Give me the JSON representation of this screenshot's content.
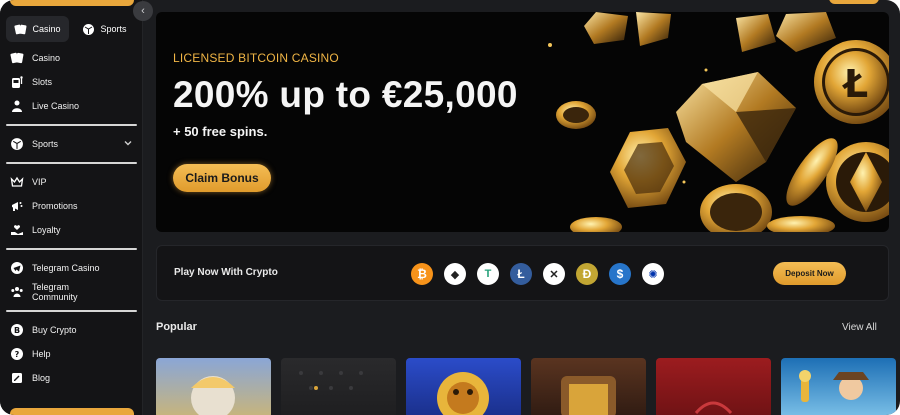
{
  "sidebar": {
    "tabs": [
      {
        "label": "Casino",
        "icon": "cards-icon"
      },
      {
        "label": "Sports",
        "icon": "ball-icon"
      }
    ],
    "group1": [
      {
        "label": "Casino",
        "icon": "cards-icon"
      },
      {
        "label": "Slots",
        "icon": "slot-machine-icon"
      },
      {
        "label": "Live Casino",
        "icon": "dealer-icon"
      }
    ],
    "group2": [
      {
        "label": "Sports",
        "icon": "ball-icon"
      }
    ],
    "group3": [
      {
        "label": "VIP",
        "icon": "crown-icon"
      },
      {
        "label": "Promotions",
        "icon": "megaphone-icon"
      },
      {
        "label": "Loyalty",
        "icon": "hand-heart-icon"
      }
    ],
    "group4": [
      {
        "label": "Telegram Casino",
        "icon": "telegram-icon"
      },
      {
        "label": "Telegram Community",
        "icon": "community-icon"
      }
    ],
    "group5": [
      {
        "label": "Buy Crypto",
        "icon": "bitcoin-icon"
      },
      {
        "label": "Help",
        "icon": "help-icon"
      },
      {
        "label": "Blog",
        "icon": "blog-icon"
      }
    ]
  },
  "hero": {
    "kicker": "LICENSED BITCOIN CASINO",
    "title": "200% up to €25,000",
    "subtitle": "+ 50 free spins.",
    "cta": "Claim Bonus"
  },
  "crypto": {
    "label": "Play Now With Crypto",
    "coins": [
      {
        "name": "bitcoin",
        "color": "#f7931a",
        "glyph": "₿"
      },
      {
        "name": "ethereum",
        "color": "#ffffff",
        "glyph": "◆"
      },
      {
        "name": "tether",
        "color": "#ffffff",
        "glyph": "T"
      },
      {
        "name": "litecoin",
        "color": "#345d9d",
        "glyph": "Ł"
      },
      {
        "name": "ripple",
        "color": "#ffffff",
        "glyph": "✕"
      },
      {
        "name": "dogecoin",
        "color": "#c2a633",
        "glyph": "Ð"
      },
      {
        "name": "usd-coin",
        "color": "#2775ca",
        "glyph": "$"
      },
      {
        "name": "cardano",
        "color": "#ffffff",
        "glyph": "✺"
      }
    ],
    "deposit": "Deposit Now"
  },
  "popular": {
    "title": "Popular",
    "view_all": "View All",
    "games": [
      {
        "name": "game-zeus",
        "colors": [
          "#8aa6d6",
          "#c9b57a"
        ]
      },
      {
        "name": "game-dark",
        "colors": [
          "#2a2a2c",
          "#1e1e20"
        ]
      },
      {
        "name": "game-lion",
        "colors": [
          "#2b4cc9",
          "#e8b53b"
        ]
      },
      {
        "name": "game-treasure",
        "colors": [
          "#5a3420",
          "#2f1b12"
        ]
      },
      {
        "name": "game-red",
        "colors": [
          "#9c1c1f",
          "#6e1214"
        ]
      },
      {
        "name": "game-explorer",
        "colors": [
          "#1d6fb5",
          "#7cc1e8"
        ]
      }
    ]
  },
  "colors": {
    "accent": "#e9a73c",
    "background": "#1b1c1f",
    "sidebar": "#141416"
  }
}
